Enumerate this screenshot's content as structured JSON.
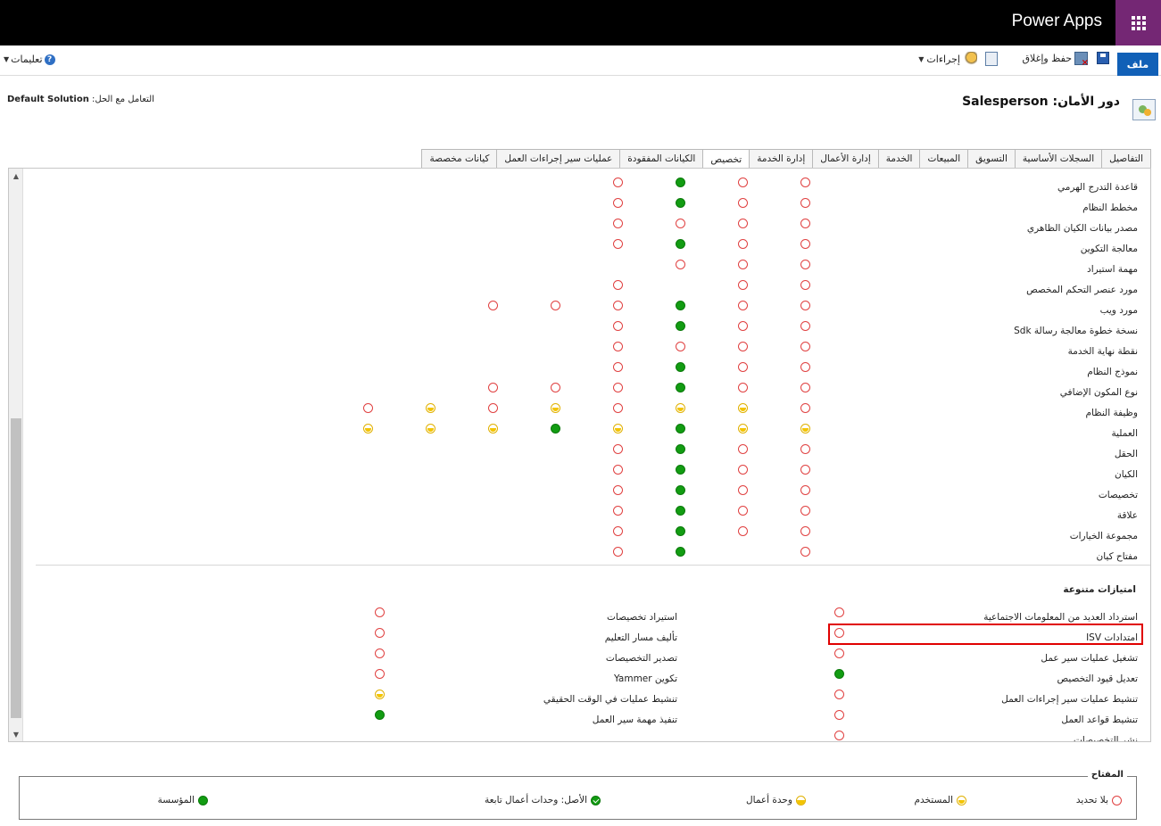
{
  "app": {
    "brand": "Power Apps"
  },
  "commandbar": {
    "file_label": "ملف",
    "save_close_label": "حفظ وإغلاق",
    "actions_label": "إجراءات",
    "help_label": "تعليمات"
  },
  "header": {
    "solution_label": "التعامل مع الحل:",
    "solution_name": "Default Solution",
    "role_label": "دور الأمان:",
    "role_name": "Salesperson"
  },
  "tabs": [
    {
      "label": "التفاصيل",
      "active": false
    },
    {
      "label": "السجلات الأساسية",
      "active": false
    },
    {
      "label": "التسويق",
      "active": false
    },
    {
      "label": "المبيعات",
      "active": false
    },
    {
      "label": "الخدمة",
      "active": false
    },
    {
      "label": "إدارة الأعمال",
      "active": false
    },
    {
      "label": "إدارة الخدمة",
      "active": false
    },
    {
      "label": "تخصيص",
      "active": true
    },
    {
      "label": "الكيانات المفقودة",
      "active": false
    },
    {
      "label": "عمليات سير إجراءات العمل",
      "active": false
    },
    {
      "label": "كيانات مخصصة",
      "active": false
    }
  ],
  "entity_rows": [
    {
      "name": "قاعدة التدرج الهرمي",
      "levels": [
        "none",
        "org",
        "none",
        "none",
        "",
        "",
        "",
        ""
      ]
    },
    {
      "name": "مخطط النظام",
      "levels": [
        "none",
        "org",
        "none",
        "none",
        "",
        "",
        "",
        ""
      ]
    },
    {
      "name": "مصدر بيانات الكيان الظاهري",
      "levels": [
        "none",
        "none",
        "none",
        "none",
        "",
        "",
        "",
        ""
      ]
    },
    {
      "name": "معالجة التكوين",
      "levels": [
        "none",
        "org",
        "none",
        "none",
        "",
        "",
        "",
        ""
      ]
    },
    {
      "name": "مهمة استيراد",
      "levels": [
        "",
        "none",
        "none",
        "none",
        "",
        "",
        "",
        ""
      ]
    },
    {
      "name": "مورد عنصر التحكم المخصص",
      "levels": [
        "none",
        "",
        "none",
        "none",
        "",
        "",
        "",
        ""
      ]
    },
    {
      "name": "مورد ويب",
      "levels": [
        "none",
        "org",
        "none",
        "none",
        "none",
        "none",
        "",
        ""
      ]
    },
    {
      "name": "نسخة خطوة معالجة رسالة Sdk",
      "levels": [
        "none",
        "org",
        "none",
        "none",
        "",
        "",
        "",
        ""
      ]
    },
    {
      "name": "نقطة نهاية الخدمة",
      "levels": [
        "none",
        "none",
        "none",
        "none",
        "",
        "",
        "",
        ""
      ]
    },
    {
      "name": "نموذج النظام",
      "levels": [
        "none",
        "org",
        "none",
        "none",
        "",
        "",
        "",
        ""
      ]
    },
    {
      "name": "نوع المكون الإضافي",
      "levels": [
        "none",
        "org",
        "none",
        "none",
        "none",
        "none",
        "",
        ""
      ]
    },
    {
      "name": "وظيفة النظام",
      "levels": [
        "none",
        "user",
        "user",
        "none",
        "none",
        "user",
        "user",
        "none"
      ]
    },
    {
      "name": "العملية",
      "levels": [
        "user",
        "org",
        "user",
        "user",
        "user",
        "org",
        "user",
        "user"
      ]
    },
    {
      "name": "الحقل",
      "levels": [
        "none",
        "org",
        "none",
        "none",
        "",
        "",
        "",
        ""
      ]
    },
    {
      "name": "الكيان",
      "levels": [
        "none",
        "org",
        "none",
        "none",
        "",
        "",
        "",
        ""
      ]
    },
    {
      "name": "تخصيصات",
      "levels": [
        "none",
        "org",
        "none",
        "none",
        "",
        "",
        "",
        ""
      ]
    },
    {
      "name": "علاقة",
      "levels": [
        "none",
        "org",
        "none",
        "none",
        "",
        "",
        "",
        ""
      ]
    },
    {
      "name": "مجموعة الخيارات",
      "levels": [
        "none",
        "org",
        "none",
        "none",
        "",
        "",
        "",
        ""
      ]
    },
    {
      "name": "مفتاح كيان",
      "levels": [
        "none",
        "org",
        "",
        "none",
        "",
        "",
        "",
        ""
      ]
    }
  ],
  "misc": {
    "title": "امتيازات متنوعة",
    "right": [
      {
        "name": "استرداد العديد من المعلومات الاجتماعية",
        "level": "none"
      },
      {
        "name": "امتدادات ISV",
        "level": "none"
      },
      {
        "name": "تشغيل عمليات سير عمل",
        "level": "none"
      },
      {
        "name": "تعديل قيود التخصيص",
        "level": "org"
      },
      {
        "name": "تنشيط عمليات سير إجراءات العمل",
        "level": "none"
      },
      {
        "name": "تنشيط قواعد العمل",
        "level": "none"
      },
      {
        "name": "نشر التخصيصات",
        "level": "none"
      }
    ],
    "left": [
      {
        "name": "استيراد تخصيصات",
        "level": "none"
      },
      {
        "name": "تأليف مسار التعليم",
        "level": "none"
      },
      {
        "name": "تصدير التخصيصات",
        "level": "none"
      },
      {
        "name": "تكوين Yammer",
        "level": "none"
      },
      {
        "name": "تنشيط عمليات في الوقت الحقيقي",
        "level": "user"
      },
      {
        "name": "تنفيذ مهمة سير العمل",
        "level": "org"
      }
    ]
  },
  "legend": {
    "title": "المفتاح",
    "items": [
      {
        "label": "بلا تحديد",
        "level": "none"
      },
      {
        "label": "المستخدم",
        "level": "user"
      },
      {
        "label": "وحدة أعمال",
        "level": "bu"
      },
      {
        "label": "الأصل: وحدات أعمال تابعة",
        "level": "parent"
      },
      {
        "label": "المؤسسة",
        "level": "org"
      }
    ]
  },
  "colors": {
    "accent": "#742774",
    "file_button": "#1160b7",
    "org": "#129c12",
    "user": "#f3c400",
    "none": "#e04040",
    "highlight": "#e00000"
  }
}
